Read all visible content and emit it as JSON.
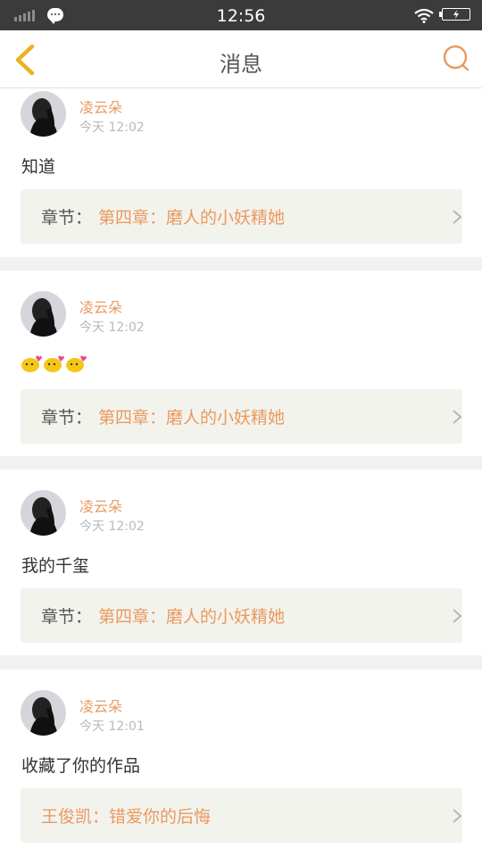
{
  "status_bar": {
    "time": "12:56"
  },
  "header": {
    "title": "消息"
  },
  "messages": [
    {
      "user": "凌云朵",
      "time": "今天 12:02",
      "text": "知道",
      "ref_label": "章节：",
      "ref_title": "第四章：磨人的小妖精她"
    },
    {
      "user": "凌云朵",
      "time": "今天 12:02",
      "emoji_icons": [
        "kiss-emoji-icon",
        "kiss-emoji-icon",
        "kiss-emoji-icon"
      ],
      "ref_label": "章节：",
      "ref_title": "第四章：磨人的小妖精她"
    },
    {
      "user": "凌云朵",
      "time": "今天 12:02",
      "text": "我的千玺",
      "ref_label": "章节：",
      "ref_title": "第四章：磨人的小妖精她"
    },
    {
      "user": "凌云朵",
      "time": "今天 12:01",
      "text": "收藏了你的作品",
      "ref_work": "王俊凯：错爱你的后悔"
    }
  ],
  "colors": {
    "accent": "#e99a5f",
    "back_arrow": "#e9b21f",
    "status_bar": "#3b3b3b",
    "ref_bg": "#f3f3ed"
  }
}
